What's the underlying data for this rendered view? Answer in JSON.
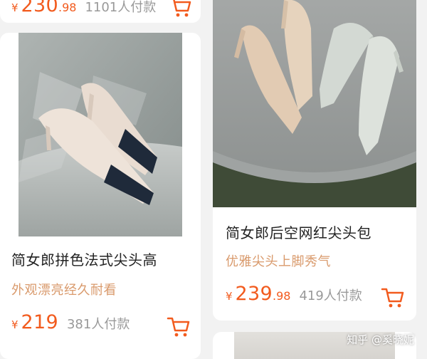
{
  "top_left_card": {
    "price_prefix": "¥",
    "price_integer": "230",
    "price_decimal": ".98",
    "sold_count": "1101人付款"
  },
  "product_card_1": {
    "title": "简女郎拼色法式尖头高",
    "tagline": "外观漂亮经久耐看",
    "price_prefix": "¥",
    "price_integer": "219",
    "sold_count": "381人付款"
  },
  "product_card_2": {
    "title": "简女郎后空网红尖头包",
    "tagline": "优雅尖头上脚秀气",
    "price_prefix": "¥",
    "price_integer": "239",
    "price_decimal": ".98",
    "sold_count": "419人付款"
  },
  "watermark": "知乎 @奚晓妮",
  "colors": {
    "price": "#f25b1e",
    "tagline": "#d99a6c",
    "sold": "#999999",
    "background": "#f2f2f2"
  },
  "icons": [
    "shopping-cart-icon"
  ]
}
